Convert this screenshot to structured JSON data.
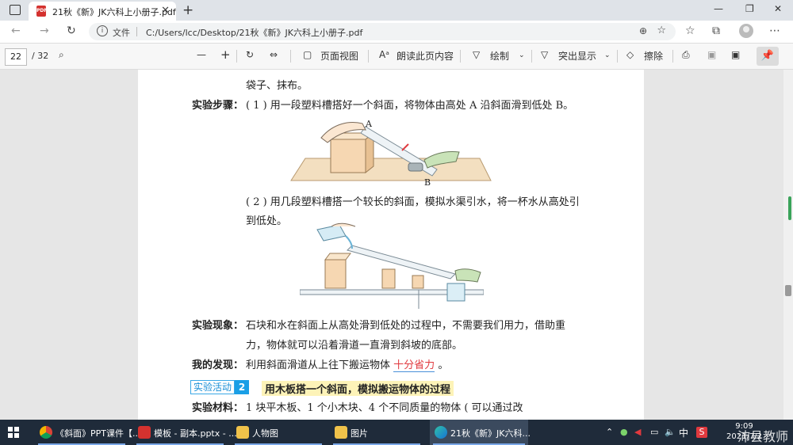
{
  "browser": {
    "tab_title": "21秋《新》JK六科上小册子.pdf",
    "address_label": "文件",
    "address_url": "C:/Users/lcc/Desktop/21秋《新》JK六科上小册子.pdf"
  },
  "pdf_toolbar": {
    "page_current": "22",
    "page_total": "/ 32",
    "page_view": "页面视图",
    "read_aloud": "朗读此页内容",
    "draw": "绘制",
    "highlight": "突出显示",
    "erase": "擦除"
  },
  "document": {
    "line_top": "袋子、抹布。",
    "steps_label": "实验步骤：",
    "step1": "( 1 ) 用一段塑料槽搭好一个斜面，将物体由高处 A 沿斜面滑到低处 B。",
    "fig1_label_a": "A",
    "fig1_label_b": "B",
    "step2_line1": "( 2 ) 用几段塑料槽搭一个较长的斜面，模拟水渠引水，将一杯水从高处引",
    "step2_line2": "到低处。",
    "phenomenon_label": "实验现象：",
    "phenomenon_line1": "石块和水在斜面上从高处滑到低处的过程中，不需要我们用力，借助重",
    "phenomenon_line2": "力，物体就可以沿着滑道一直滑到斜坡的底部。",
    "finding_label": "我的发现：",
    "finding_text": "利用斜面滑道从上往下搬运物体",
    "finding_answer": "十分省力",
    "finding_end": "。",
    "activity_tag": "实验活动",
    "activity_num": "2",
    "activity_title": "用木板搭一个斜面，模拟搬运物体的过程",
    "materials_label": "实验材料：",
    "materials_text": "1 块平木板、1 个小木块、4 个不同质量的物体 ( 可以通过改"
  },
  "taskbar": {
    "apps": [
      {
        "label": "《斜面》PPT课件【..."
      },
      {
        "label": "模板 - 副本.pptx - ..."
      },
      {
        "label": "人物图"
      },
      {
        "label": "图片"
      },
      {
        "label": "21秋《新》JK六科..."
      }
    ],
    "ime": "中",
    "time": "9:09",
    "date": "2021/7/2"
  },
  "watermark": "沛县教师",
  "colors": {
    "accent_blue": "#1a9fe6",
    "answer_red": "#e0393e",
    "taskbar": "#1f2b3a"
  }
}
